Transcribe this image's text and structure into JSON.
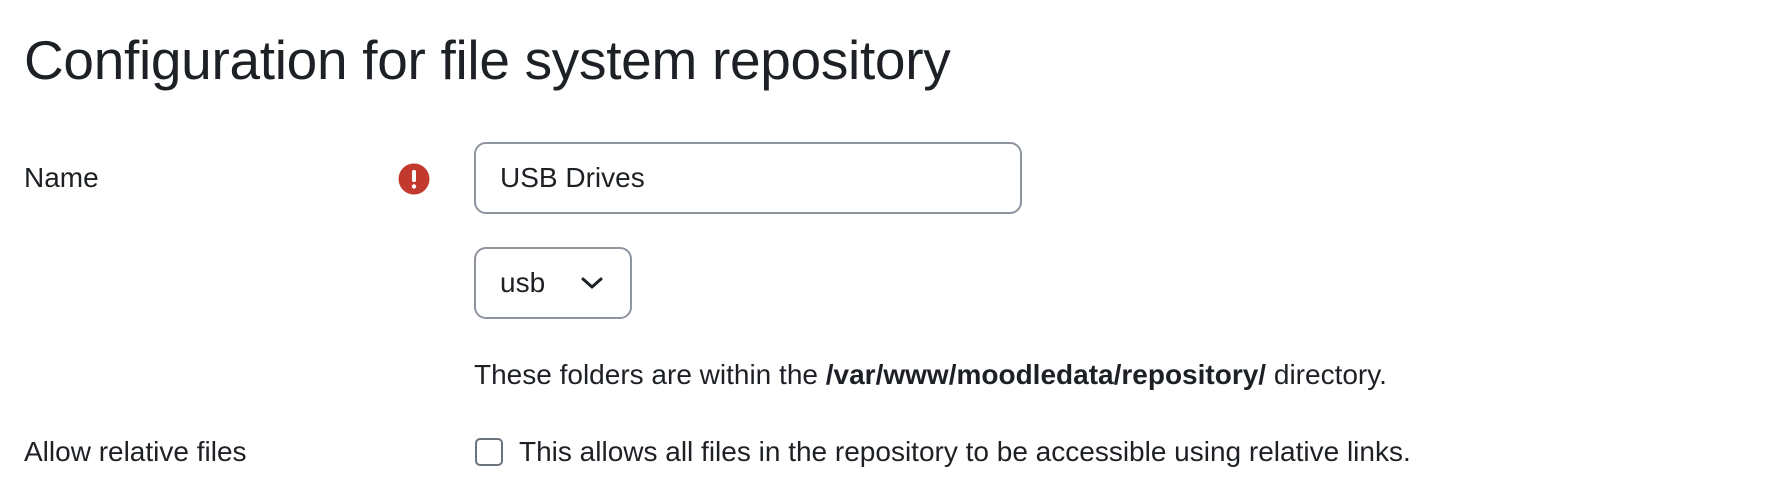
{
  "page": {
    "title": "Configuration for file system repository"
  },
  "form": {
    "name": {
      "label": "Name",
      "value": "USB Drives",
      "required_icon": "exclamation-circle-icon",
      "required_color": "#c2392d"
    },
    "folder": {
      "selected": "usb",
      "icon": "chevron-down-icon",
      "help_prefix": "These folders are within the ",
      "help_path": "/var/www/moodledata/repository/",
      "help_suffix": " directory."
    },
    "relative_files": {
      "label": "Allow relative files",
      "checked": false,
      "description": "This allows all files in the repository to be accessible using relative links."
    }
  }
}
